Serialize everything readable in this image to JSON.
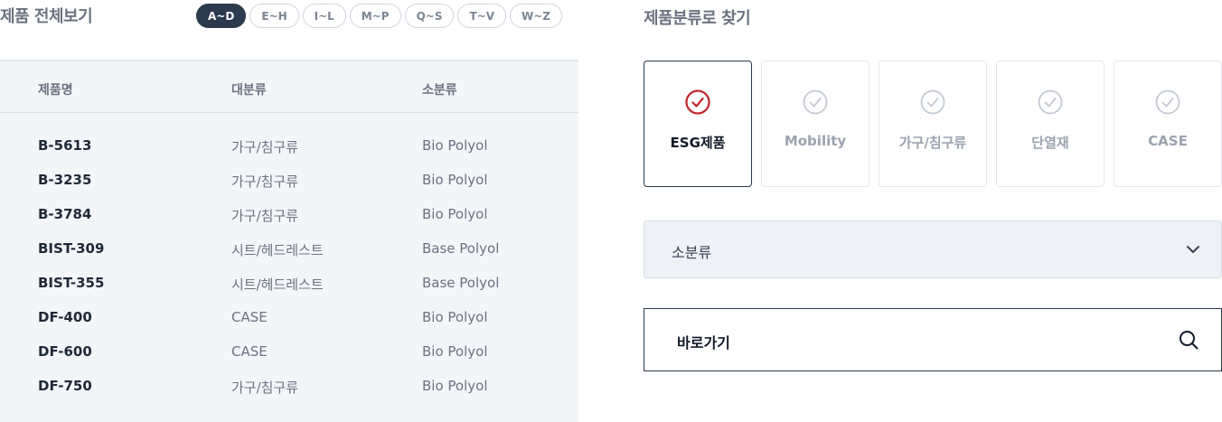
{
  "left": {
    "title": "제품 전체보기",
    "alpha_tabs": [
      {
        "label": "A~D",
        "active": true
      },
      {
        "label": "E~H",
        "active": false
      },
      {
        "label": "I~L",
        "active": false
      },
      {
        "label": "M~P",
        "active": false
      },
      {
        "label": "Q~S",
        "active": false
      },
      {
        "label": "T~V",
        "active": false
      },
      {
        "label": "W~Z",
        "active": false
      }
    ],
    "table": {
      "headers": [
        "제품명",
        "대분류",
        "소분류"
      ],
      "rows": [
        {
          "name": "B-5613",
          "major": "가구/침구류",
          "minor": "Bio Polyol"
        },
        {
          "name": "B-3235",
          "major": "가구/침구류",
          "minor": "Bio Polyol"
        },
        {
          "name": "B-3784",
          "major": "가구/침구류",
          "minor": "Bio Polyol"
        },
        {
          "name": "BIST-309",
          "major": "시트/헤드레스트",
          "minor": "Base Polyol"
        },
        {
          "name": "BIST-355",
          "major": "시트/헤드레스트",
          "minor": "Base Polyol"
        },
        {
          "name": "DF-400",
          "major": "CASE",
          "minor": "Bio Polyol"
        },
        {
          "name": "DF-600",
          "major": "CASE",
          "minor": "Bio Polyol"
        },
        {
          "name": "DF-750",
          "major": "가구/침구류",
          "minor": "Bio Polyol"
        }
      ]
    }
  },
  "right": {
    "title": "제품분류로 찾기",
    "categories": [
      {
        "label": "ESG제품",
        "active": true,
        "icon": "check-circle-icon"
      },
      {
        "label": "Mobility",
        "active": false,
        "icon": "check-circle-icon"
      },
      {
        "label": "가구/침구류",
        "active": false,
        "icon": "check-circle-icon"
      },
      {
        "label": "단열재",
        "active": false,
        "icon": "check-circle-icon"
      },
      {
        "label": "CASE",
        "active": false,
        "icon": "check-circle-icon"
      }
    ],
    "subcategory_select": {
      "value": "소분류",
      "icon": "chevron-down-icon"
    },
    "goto": {
      "label": "바로가기",
      "icon": "search-icon"
    }
  },
  "colors": {
    "accent_dark": "#2b3a4d",
    "active_check": "#c0262d",
    "inactive_check": "#c3cad3",
    "panel_bg": "#f3f6f9"
  }
}
